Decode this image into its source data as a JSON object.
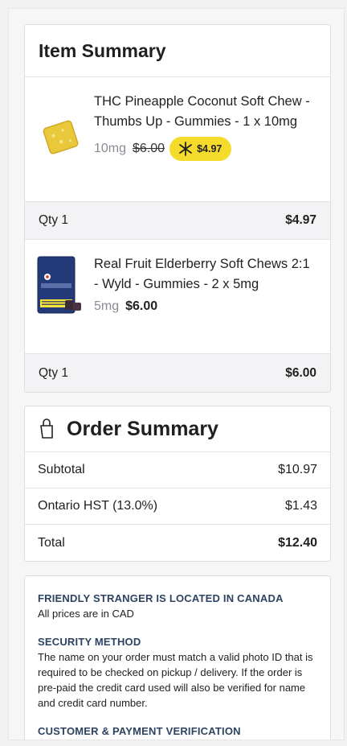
{
  "item_summary": {
    "title": "Item Summary",
    "products": [
      {
        "name": "THC Pineapple Coconut Soft Chew - Thumbs Up - Gummies - 1 x 10mg",
        "dosage": "10mg",
        "original_price": "$6.00",
        "sale_price": "$4.97",
        "sale_icon": "sparkle-icon",
        "image_icon": "yellow-gummy-icon",
        "qty_label": "Qty 1",
        "line_total": "$4.97"
      },
      {
        "name": "Real Fruit Elderberry Soft Chews 2:1 - Wyld - Gummies - 2 x 5mg",
        "dosage": "5mg",
        "price": "$6.00",
        "image_icon": "gummy-package-icon",
        "qty_label": "Qty 1",
        "line_total": "$6.00"
      }
    ]
  },
  "order_summary": {
    "title": "Order Summary",
    "icon": "shopping-bag-icon",
    "subtotal_label": "Subtotal",
    "subtotal": "$10.97",
    "tax_label": "Ontario HST (13.0%)",
    "tax": "$1.43",
    "total_label": "Total",
    "total": "$12.40"
  },
  "info": {
    "location_heading": "FRIENDLY STRANGER IS LOCATED IN CANADA",
    "location_text": "All prices are in CAD",
    "security_heading": "SECURITY METHOD",
    "security_text": "The name on your order must match a valid photo ID that is required to be checked on pickup / delivery. If the order is pre-paid the credit card used will also be verified for name and credit card number.",
    "verification_heading": "CUSTOMER & PAYMENT VERIFICATION"
  },
  "colors": {
    "sale_badge": "#f5db2c",
    "heading_blue": "#2d4361",
    "qty_row_bg": "#f3f3f5"
  }
}
